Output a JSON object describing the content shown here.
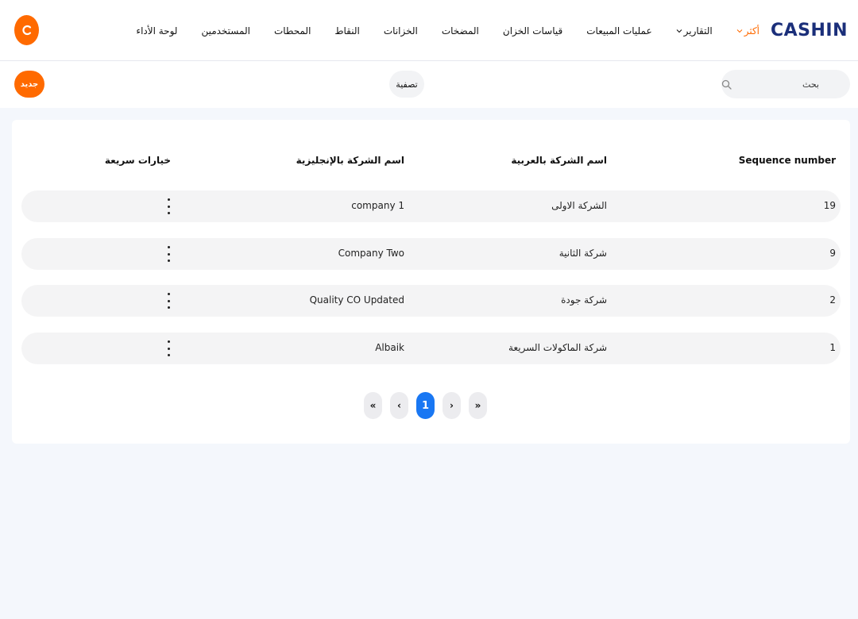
{
  "brand": {
    "logo_text": "CASHIN",
    "accent_color": "#ff6a00",
    "logo_color": "#1b2f7a"
  },
  "nav": {
    "items": [
      {
        "label": "لوحة الأداء"
      },
      {
        "label": "المستخدمين"
      },
      {
        "label": "المحطات"
      },
      {
        "label": "النقاط"
      },
      {
        "label": "الخزانات"
      },
      {
        "label": "المضخات"
      },
      {
        "label": "قياسات الخزان"
      },
      {
        "label": "عمليات المبيعات"
      },
      {
        "label": "التقارير"
      },
      {
        "label": "أكثر"
      }
    ]
  },
  "user": {
    "avatar_initial": "C"
  },
  "toolbar": {
    "search_placeholder": "بحث",
    "filter_label": "تصفية",
    "new_label": "جديد"
  },
  "table": {
    "columns": [
      "Sequence number",
      "اسم الشركة بالعربية",
      "اسم الشركة بالإنجليزية",
      "خيارات سريعة"
    ],
    "rows": [
      {
        "seq": "19",
        "name_ar": "الشركة الاولى",
        "name_en": "company 1"
      },
      {
        "seq": "9",
        "name_ar": "شركة الثانية",
        "name_en": "Company Two"
      },
      {
        "seq": "2",
        "name_ar": "شركة جودة",
        "name_en": "Quality CO Updated"
      },
      {
        "seq": "1",
        "name_ar": "شركة الماكولات السريعة",
        "name_en": "Albaik"
      }
    ]
  },
  "pagination": {
    "first": "«",
    "prev": "‹",
    "current": "1",
    "next": "›",
    "last": "»",
    "active_color": "#1977f3"
  }
}
